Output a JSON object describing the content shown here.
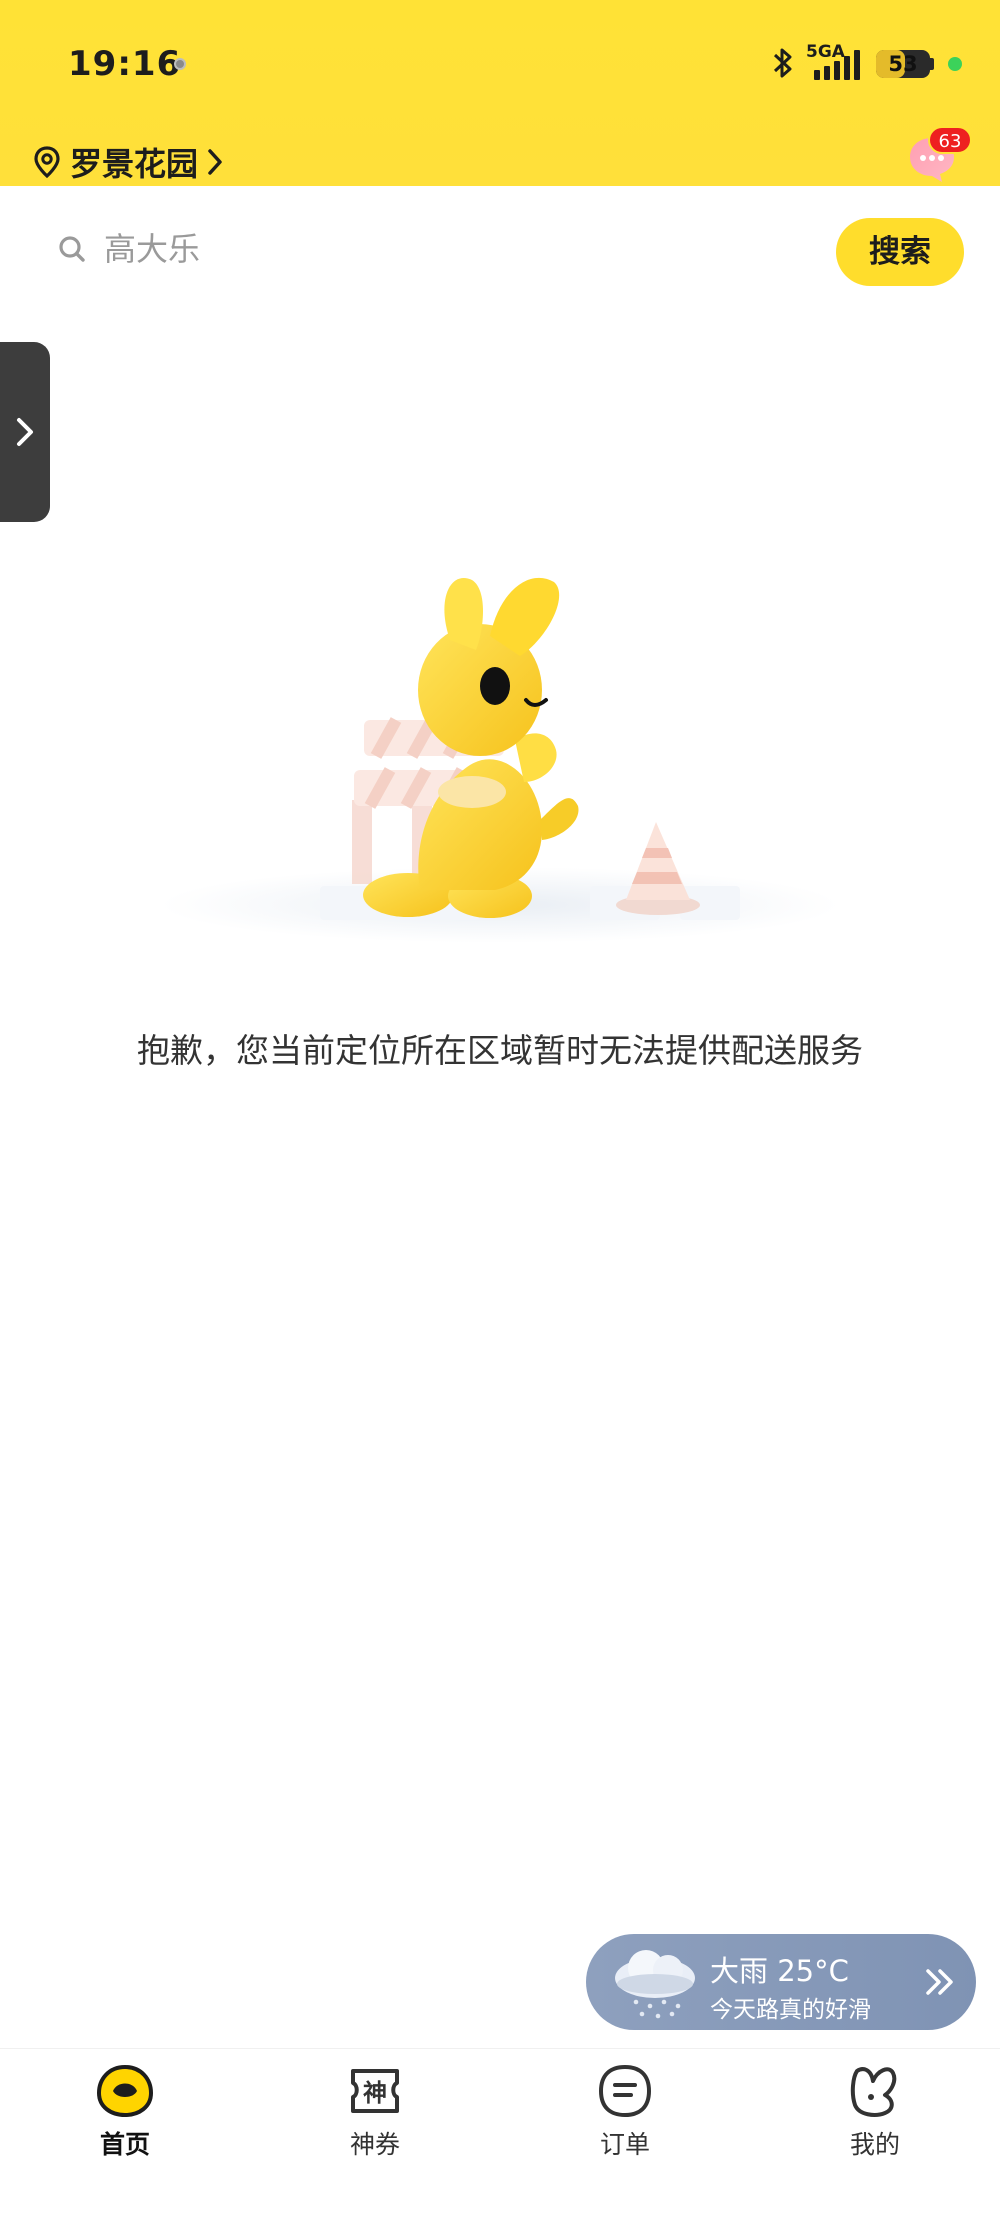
{
  "status_bar": {
    "time": "19:16",
    "network": "5GA",
    "battery": "53",
    "battery_level": 0.53
  },
  "header": {
    "location": "罗景花园",
    "message_badge": "63"
  },
  "search": {
    "placeholder": "高大乐",
    "button_label": "搜索"
  },
  "main": {
    "empty_message": "抱歉，您当前定位所在区域暂时无法提供配送服务"
  },
  "weather": {
    "title": "大雨 25°C",
    "subtitle": "今天路真的好滑"
  },
  "tabs": [
    {
      "label": "首页",
      "icon": "home-face-icon",
      "active": true
    },
    {
      "label": "神券",
      "icon": "coupon-icon",
      "active": false
    },
    {
      "label": "订单",
      "icon": "order-icon",
      "active": false
    },
    {
      "label": "我的",
      "icon": "profile-icon",
      "active": false
    }
  ],
  "colors": {
    "brand_yellow": "#FFE236",
    "search_button": "#FFDD2C",
    "badge_red": "#EE2020",
    "weather_card": "#8EA0BE"
  }
}
